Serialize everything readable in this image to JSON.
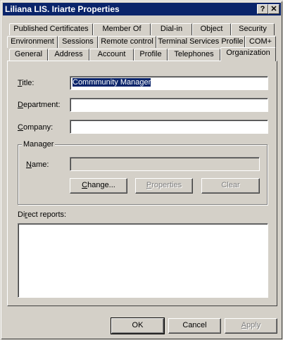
{
  "window": {
    "title": "Liliana LIS. Iriarte Properties",
    "help_button": "?",
    "close_button": "✕"
  },
  "tabs": {
    "row1": [
      "Published Certificates",
      "Member Of",
      "Dial-in",
      "Object",
      "Security"
    ],
    "row2": [
      "Environment",
      "Sessions",
      "Remote control",
      "Terminal Services Profile",
      "COM+"
    ],
    "row3": [
      "General",
      "Address",
      "Account",
      "Profile",
      "Telephones",
      "Organization"
    ],
    "active": "Organization"
  },
  "organization": {
    "title_label": "Title:",
    "title_value": "Commmunity Manager",
    "department_label": "Department:",
    "department_value": "",
    "company_label": "Company:",
    "company_value": "",
    "manager_group": "Manager",
    "manager_name_label": "Name:",
    "manager_name_value": "",
    "change_button": "Change...",
    "properties_button": "Properties",
    "clear_button": "Clear",
    "direct_reports_label": "Direct reports:",
    "direct_reports": []
  },
  "footer": {
    "ok": "OK",
    "cancel": "Cancel",
    "apply": "Apply"
  }
}
